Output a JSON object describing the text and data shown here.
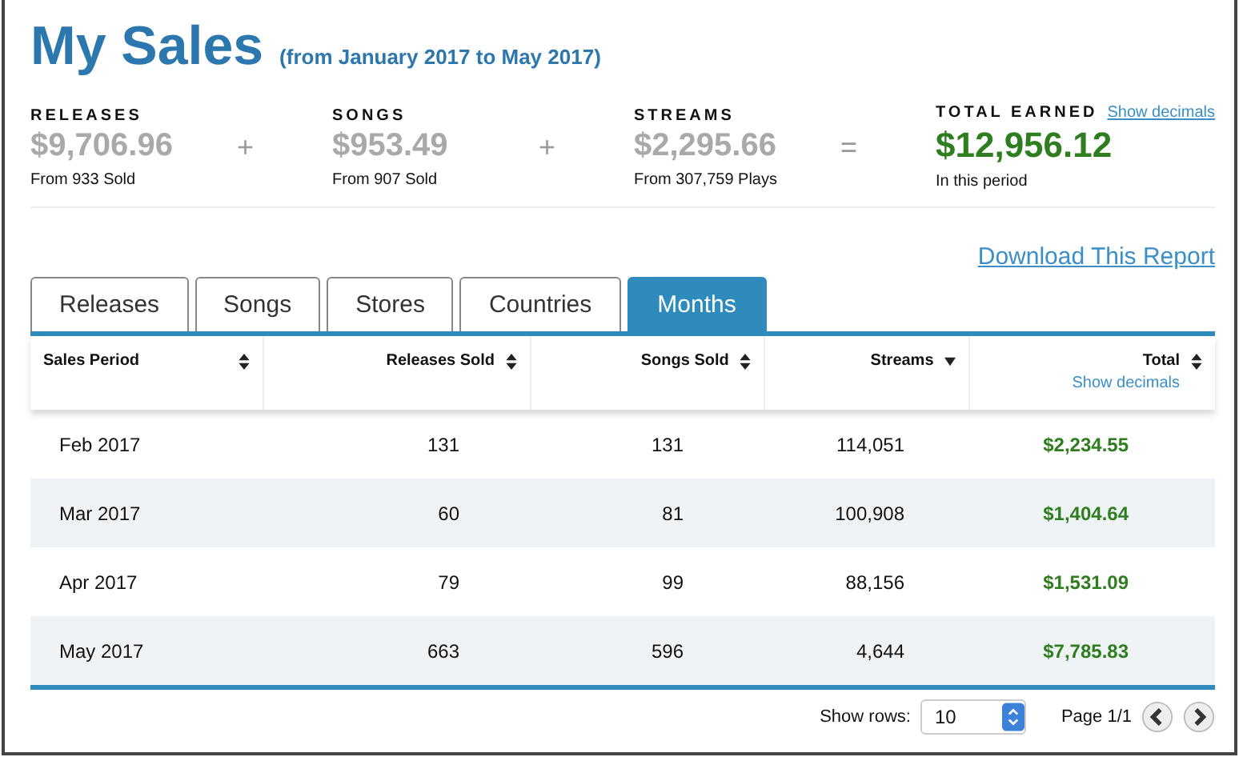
{
  "title": "My Sales",
  "subtitle": "(from January 2017 to May 2017)",
  "stats": [
    {
      "kind": "part",
      "label": "RELEASES",
      "amount": "$9,706.96",
      "note": "From 933 Sold"
    },
    {
      "kind": "part",
      "operator": "+",
      "label": "SONGS",
      "amount": "$953.49",
      "note": "From 907 Sold"
    },
    {
      "kind": "part",
      "operator": "+",
      "label": "STREAMS",
      "amount": "$2,295.66",
      "note": "From 307,759 Plays"
    },
    {
      "kind": "total",
      "operator": "=",
      "label": "TOTAL EARNED",
      "link": "Show decimals",
      "amount": "$12,956.12",
      "note": "In this period"
    }
  ],
  "download_link": "Download This Report",
  "tabs": [
    {
      "label": "Releases",
      "selected": false
    },
    {
      "label": "Songs",
      "selected": false
    },
    {
      "label": "Stores",
      "selected": false
    },
    {
      "label": "Countries",
      "selected": false
    },
    {
      "label": "Months",
      "selected": true
    }
  ],
  "table": {
    "columns": [
      {
        "label": "Sales Period",
        "kind": "sortable"
      },
      {
        "label": "Releases Sold",
        "kind": "sortable"
      },
      {
        "label": "Songs Sold",
        "kind": "sortable"
      },
      {
        "label": "Streams",
        "kind": "sorted"
      },
      {
        "label": "Total",
        "kind": "sortable",
        "link": "Show decimals"
      }
    ],
    "rows": [
      [
        "Feb 2017",
        "131",
        "131",
        "114,051",
        "$2,234.55"
      ],
      [
        "Mar 2017",
        "60",
        "81",
        "100,908",
        "$1,404.64"
      ],
      [
        "Apr 2017",
        "79",
        "99",
        "88,156",
        "$1,531.09"
      ],
      [
        "May 2017",
        "663",
        "596",
        "4,644",
        "$7,785.83"
      ]
    ]
  },
  "footer": {
    "rows_label": "Show rows:",
    "rows_value": "10",
    "page": "Page 1/1"
  }
}
